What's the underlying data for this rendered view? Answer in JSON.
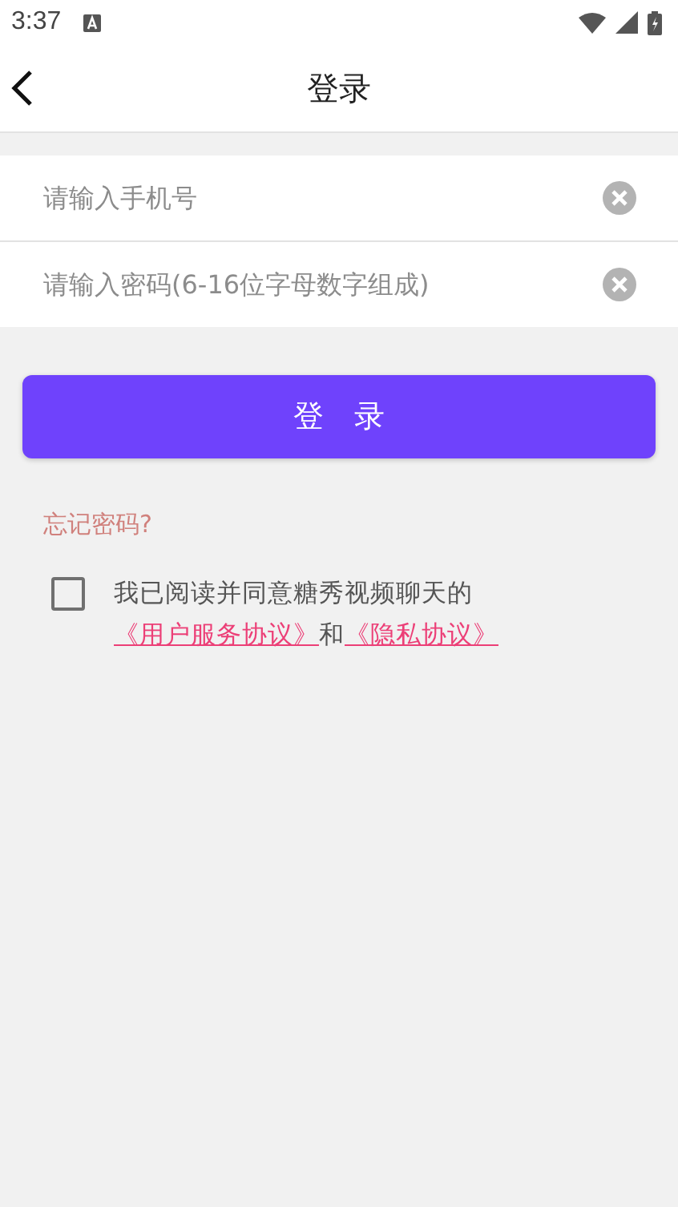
{
  "status_bar": {
    "time": "3:37"
  },
  "header": {
    "title": "登录"
  },
  "fields": [
    {
      "placeholder": "请输入手机号"
    },
    {
      "placeholder": "请输入密码(6-16位字母数字组成)"
    }
  ],
  "login_button": "登　录",
  "forgot_link": "忘记密码?",
  "agreement": {
    "checked": false,
    "text": "我已阅读并同意糖秀视频聊天的",
    "link_1": "《用户服务协议》",
    "joiner": "和",
    "link_2": "《隐私协议》"
  }
}
